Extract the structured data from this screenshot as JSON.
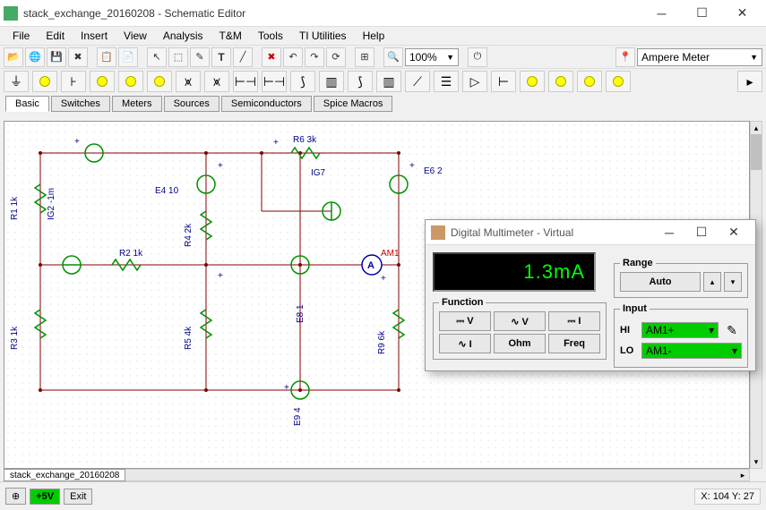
{
  "window": {
    "title": "stack_exchange_20160208 - Schematic Editor",
    "doc_tab": "stack_exchange_20160208"
  },
  "menu": [
    "File",
    "Edit",
    "Insert",
    "View",
    "Analysis",
    "T&M",
    "Tools",
    "TI Utilities",
    "Help"
  ],
  "toolbar": {
    "zoom": "100%",
    "device_combo": "Ampere Meter"
  },
  "component_tabs": [
    "Basic",
    "Switches",
    "Meters",
    "Sources",
    "Semiconductors",
    "Spice Macros"
  ],
  "circuit_labels": {
    "R1": "R1 1k",
    "R2": "R2 1k",
    "R3": "R3 1k",
    "R4": "R4 2k",
    "R5": "R5 4k",
    "R6": "R6 3k",
    "R9": "R9 6k",
    "IG2": "IG2 -1m",
    "IG7": "IG7",
    "E4": "E4 10",
    "E6": "E6 2",
    "E8": "E8 1",
    "E9": "E9 4",
    "AM1": "AM1",
    "A": "A"
  },
  "multimeter": {
    "title": "Digital Multimeter - Virtual",
    "display": "1.3mA",
    "function_label": "Function",
    "functions": [
      "⎓ V",
      "∿ V",
      "⎓ I",
      "∿ I",
      "Ohm",
      "Freq"
    ],
    "range_label": "Range",
    "range_auto": "Auto",
    "input_label": "Input",
    "hi_label": "HI",
    "lo_label": "LO",
    "hi_value": "AM1+",
    "lo_value": "AM1-"
  },
  "status": {
    "voltage": "+5V",
    "exit": "Exit",
    "coords": "X: 104  Y: 27"
  }
}
